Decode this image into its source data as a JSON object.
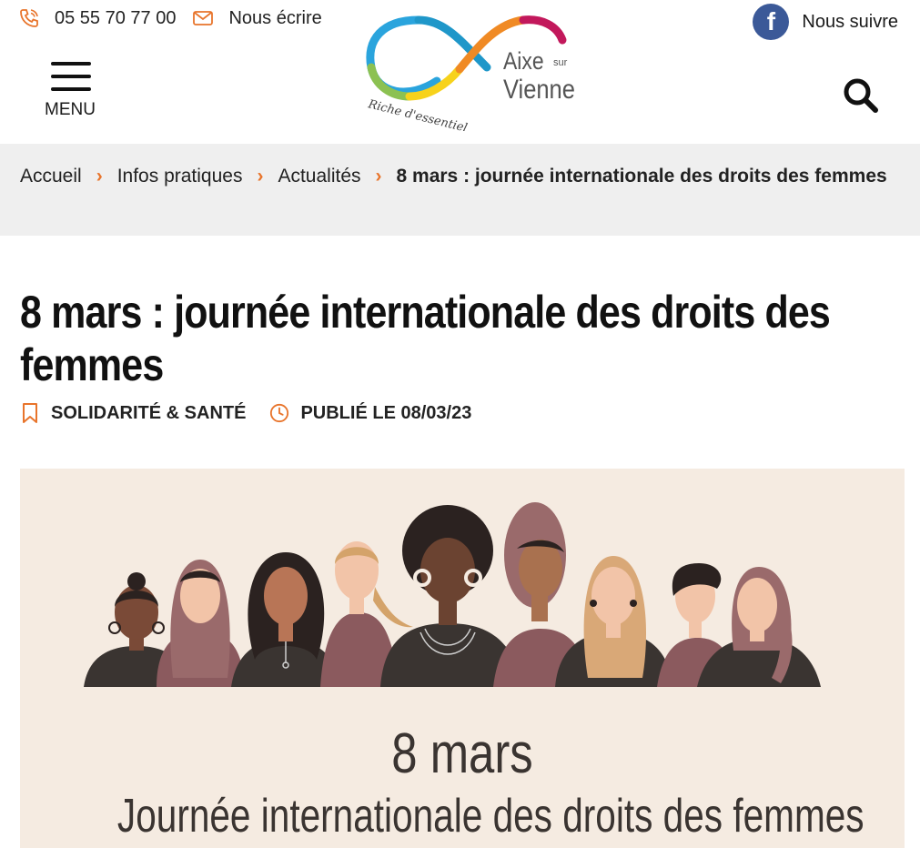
{
  "header": {
    "phone": "05 55 70 77 00",
    "write_label": "Nous écrire",
    "follow_label": "Nous suivre",
    "menu_label": "MENU",
    "logo": {
      "line1": "Aixe",
      "sur": "sur",
      "line2": "Vienne",
      "tagline": "Riche d'essentiel"
    }
  },
  "breadcrumb": {
    "items": [
      "Accueil",
      "Infos pratiques",
      "Actualités"
    ],
    "current": "8 mars : journée internationale des droits des femmes"
  },
  "article": {
    "title": "8 mars : journée internationale des droits des femmes",
    "category": "SOLIDARITÉ & SANTÉ",
    "published": "PUBLIÉ LE 08/03/23"
  },
  "hero": {
    "date_text": "8 mars",
    "caption": "Journée internationale des droits des femmes"
  },
  "colors": {
    "accent": "#e8742b",
    "breadcrumb_bg": "#efefef",
    "hero_bg": "#f5ebe1",
    "facebook": "#3b5998"
  }
}
